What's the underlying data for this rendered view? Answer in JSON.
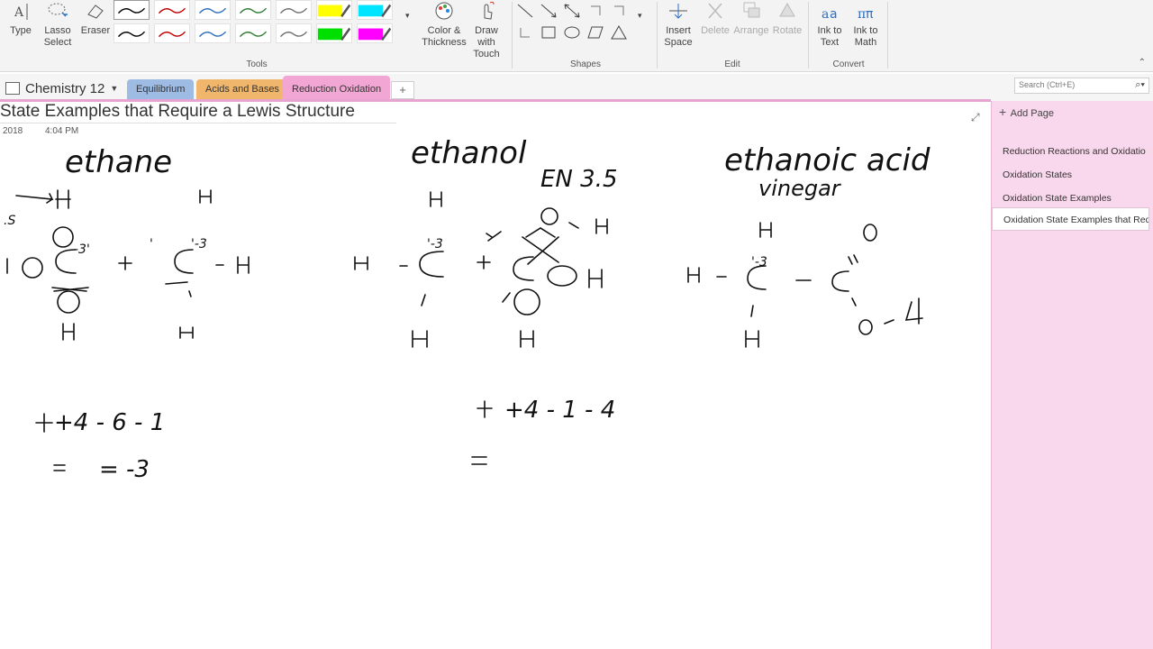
{
  "ribbon": {
    "type_label": "Type",
    "lasso_label_1": "Lasso",
    "lasso_label_2": "Select",
    "eraser_label": "Eraser",
    "color_label_1": "Color &",
    "color_label_2": "Thickness",
    "touch_label_1": "Draw with",
    "touch_label_2": "Touch",
    "insert_space_1": "Insert",
    "insert_space_2": "Space",
    "delete_label": "Delete",
    "arrange_label": "Arrange",
    "rotate_label": "Rotate",
    "ink_text_1": "Ink to",
    "ink_text_2": "Text",
    "ink_math_1": "Ink to",
    "ink_math_2": "Math",
    "groups": {
      "tools": "Tools",
      "shapes": "Shapes",
      "edit": "Edit",
      "convert": "Convert"
    },
    "pens": [
      {
        "color": "#000000",
        "highlighter": false
      },
      {
        "color": "#c00000",
        "highlighter": false
      },
      {
        "color": "#2e6fbf",
        "highlighter": false
      },
      {
        "color": "#2e7d32",
        "highlighter": false
      },
      {
        "color": "#707070",
        "highlighter": false
      },
      {
        "color": "#ffff00",
        "highlighter": true
      },
      {
        "color": "#00e5ff",
        "highlighter": true
      },
      {
        "color": "#000000",
        "highlighter": false
      },
      {
        "color": "#c00000",
        "highlighter": false
      },
      {
        "color": "#2e6fbf",
        "highlighter": false
      },
      {
        "color": "#2e7d32",
        "highlighter": false
      },
      {
        "color": "#707070",
        "highlighter": false
      },
      {
        "color": "#00e000",
        "highlighter": true
      },
      {
        "color": "#ff00ff",
        "highlighter": true
      }
    ],
    "shape_icons": [
      "line-icon",
      "arrow-icon",
      "double-arrow-icon",
      "axis-icon",
      "axis-2-icon",
      "axis-3-icon",
      "rectangle-icon",
      "ellipse-icon",
      "parallelogram-icon",
      "triangle-icon"
    ]
  },
  "notebook": {
    "name": "Chemistry 12"
  },
  "sections": [
    {
      "label": "Equilibrium",
      "color": "#9dbbe3"
    },
    {
      "label": "Acids and Bases",
      "color": "#f0b66b"
    },
    {
      "label": "Reduction Oxidation",
      "color": "#f2a6d3"
    }
  ],
  "add_section": "+",
  "search": {
    "placeholder": "Search (Ctrl+E)"
  },
  "page": {
    "title": "State Examples that Require a Lewis Structure",
    "date": "2018",
    "time": "4:04 PM"
  },
  "ink": {
    "ethane": "ethane",
    "ethanol": "ethanol",
    "ethanoic": "ethanoic acid",
    "vinegar": "vinegar",
    "en": "EN 3.5",
    "calc1_line1": "+4 - 6 - 1",
    "calc1_line2": "= -3",
    "calc2_line1": "+4 - 1 - 4",
    "calc2_line2": "="
  },
  "pages_panel": {
    "add_page": "Add Page",
    "items": [
      "Reduction Reactions and Oxidatio",
      "Oxidation States",
      "Oxidation State Examples",
      "Oxidation State Examples that Req"
    ]
  }
}
